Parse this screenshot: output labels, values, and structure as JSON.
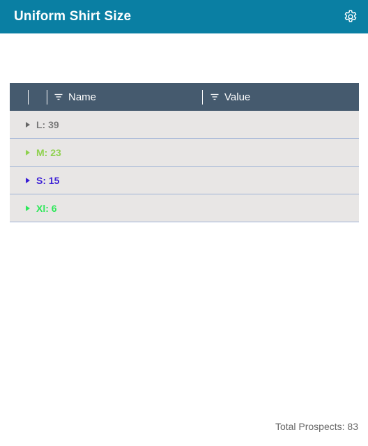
{
  "header": {
    "title": "Uniform Shirt Size",
    "settings_icon": "gear-icon"
  },
  "grid": {
    "columns": [
      {
        "label": "Name",
        "icon": "filter-icon"
      },
      {
        "label": "Value",
        "icon": "filter-icon"
      }
    ],
    "rows": [
      {
        "label": "L: 39",
        "color": "#7a7a7a"
      },
      {
        "label": "M: 23",
        "color": "#8fd14f"
      },
      {
        "label": "S: 15",
        "color": "#3b1fd6"
      },
      {
        "label": "Xl: 6",
        "color": "#2ee85a"
      }
    ]
  },
  "footer": {
    "total_label": "Total Prospects: 83"
  }
}
